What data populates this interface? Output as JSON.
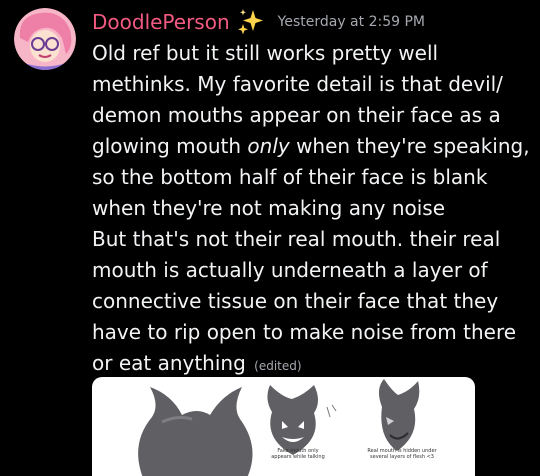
{
  "message": {
    "username": "DoodlePerson",
    "username_color": "#f25a82",
    "badge_icon": "sparkles-icon",
    "timestamp": "Yesterday at 2:59 PM",
    "lines": [
      "Old ref but it still works pretty well",
      "methinks. My favorite detail is that devil/",
      "demon mouths appear on their face as a",
      "glowing mouth ",
      "only",
      " when they're speaking,",
      "so the bottom half of their face is blank",
      "when they're not making any noise",
      "But that's not their real mouth. their real",
      "mouth is actually underneath a layer of",
      "connective tissue on their face that they",
      "have to rip open to make noise from there",
      "or eat anything"
    ],
    "edited_label": "(edited)"
  },
  "attachment": {
    "caption_fake_mouth": "Fake mouth only appears while talking",
    "caption_real_mouth": "Real mouth is hidden under several layers of flesh <3"
  }
}
